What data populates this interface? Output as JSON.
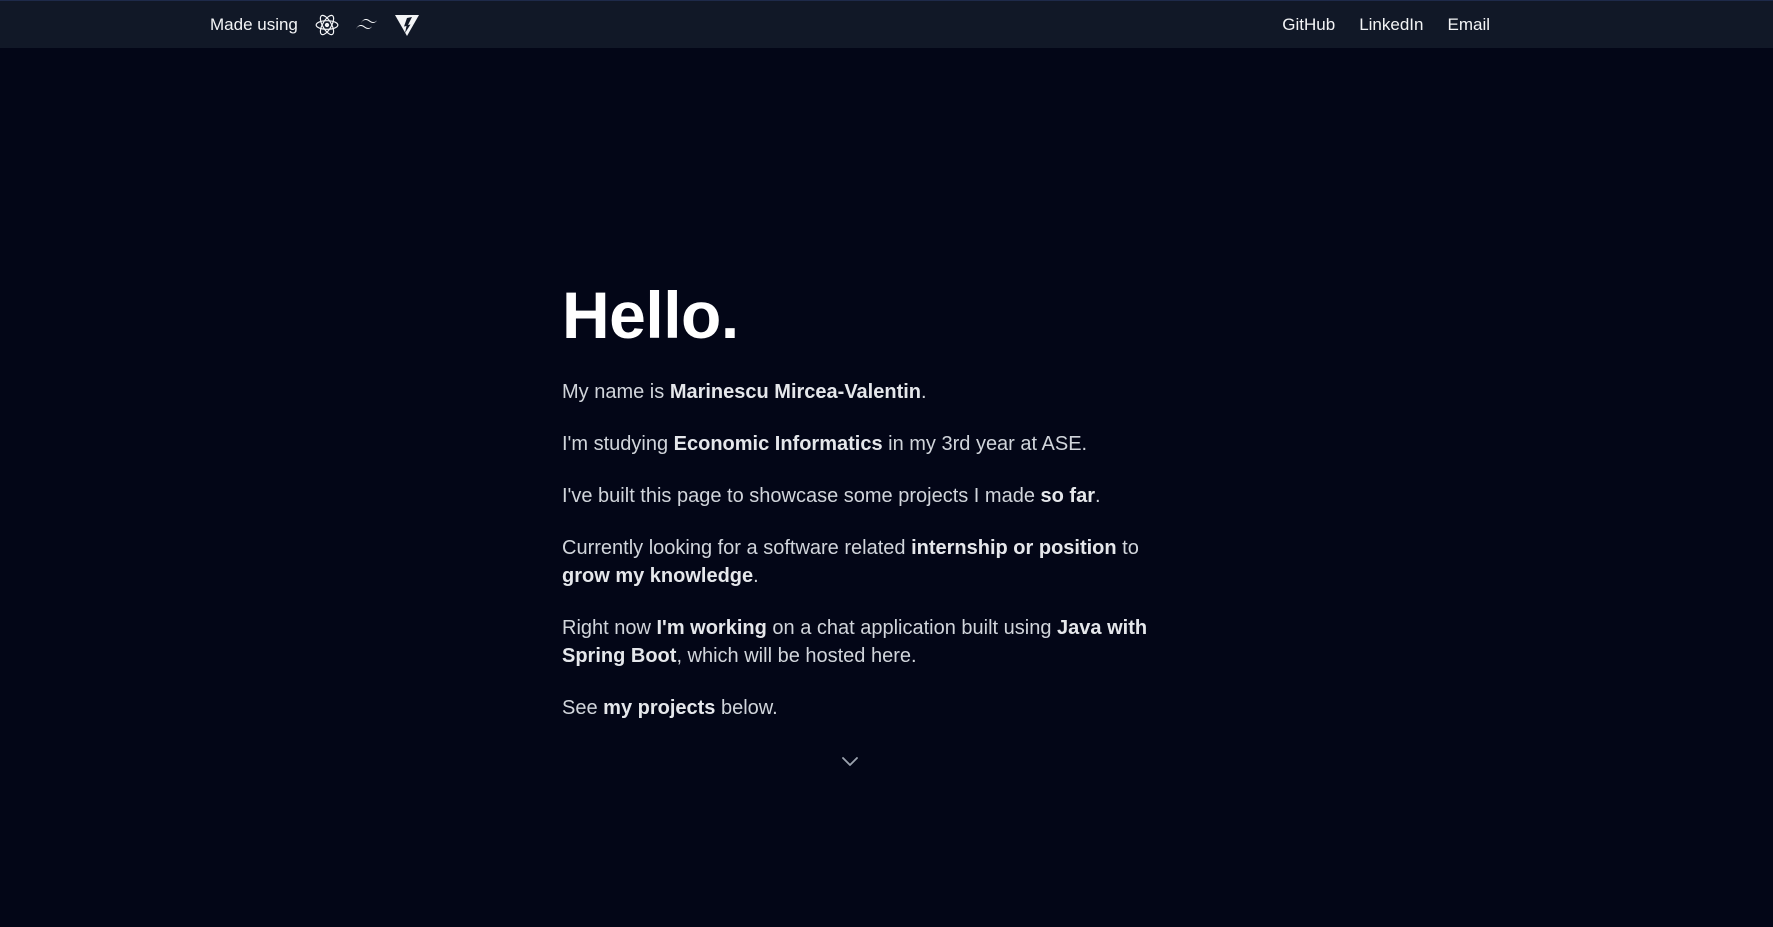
{
  "nav": {
    "made_using": "Made using",
    "tech_icons": [
      "react-icon",
      "tailwind-icon",
      "vite-icon"
    ],
    "links": [
      "GitHub",
      "LinkedIn",
      "Email"
    ]
  },
  "hero": {
    "title": "Hello.",
    "p1": {
      "a": "My name is ",
      "b": "Marinescu Mircea-Valentin",
      "c": "."
    },
    "p2": {
      "a": "I'm studying ",
      "b": "Economic Informatics",
      "c": " in my 3rd year at ASE."
    },
    "p3": {
      "a": "I've built this page to showcase some projects I made ",
      "b": "so far",
      "c": "."
    },
    "p4": {
      "a": "Currently looking for a software related ",
      "b": "internship or position",
      "c": " to ",
      "d": "grow my knowledge",
      "e": "."
    },
    "p5": {
      "a": "Right now ",
      "b": "I'm working",
      "c": " on a chat application built using ",
      "d": "Java with Spring Boot",
      "e": ", which will be hosted here."
    },
    "p6": {
      "a": "See ",
      "b": "my projects",
      "c": " below."
    }
  },
  "scroll_icon": "chevron-down-icon",
  "colors": {
    "background": "#030617",
    "navbar": "#111827",
    "text": "#d1d5db",
    "heading": "#ffffff"
  }
}
